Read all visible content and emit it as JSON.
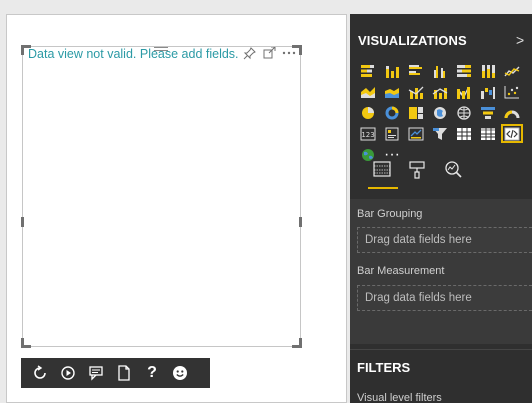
{
  "colors": {
    "accent": "#e6b800",
    "message": "#2b9aa5",
    "pane_bg": "#2f2f2f",
    "toolbar_bg": "#333333"
  },
  "visual": {
    "message": "Data view not valid. Please add fields.",
    "header_icons": [
      "pin-icon",
      "focus-mode-icon",
      "more-options-icon"
    ]
  },
  "floating_toolbar": {
    "icons": [
      "refresh-icon",
      "play-icon",
      "comment-icon",
      "new-page-icon",
      "help-icon",
      "smiley-icon"
    ],
    "help_label": "?"
  },
  "visualizations": {
    "header": "VISUALIZATIONS",
    "collapse_glyph": ">",
    "gallery": [
      "stacked-bar-icon",
      "stacked-column-icon",
      "clustered-bar-icon",
      "clustered-column-icon",
      "100-stacked-bar-icon",
      "100-stacked-column-icon",
      "line-chart-icon",
      "area-chart-icon",
      "stacked-area-icon",
      "line-column-icon",
      "line-stacked-column-icon",
      "ribbon-chart-icon",
      "waterfall-icon",
      "scatter-icon",
      "pie-chart-icon",
      "donut-chart-icon",
      "treemap-icon",
      "map-icon",
      "filled-map-icon",
      "funnel-icon",
      "gauge-icon",
      "card-icon",
      "multi-row-card-icon",
      "kpi-icon",
      "slicer-icon",
      "table-icon",
      "matrix-icon",
      "custom-visual-icon",
      "globe-icon",
      "more-visuals-icon"
    ],
    "more_glyph": "···",
    "selected": "custom-visual-icon",
    "tabs": [
      "fields-tab",
      "format-tab",
      "analytics-tab"
    ]
  },
  "fields": {
    "wells": [
      {
        "label": "Bar Grouping",
        "placeholder": "Drag data fields here"
      },
      {
        "label": "Bar Measurement",
        "placeholder": "Drag data fields here"
      }
    ]
  },
  "filters": {
    "header": "FILTERS",
    "sub": "Visual level filters"
  }
}
